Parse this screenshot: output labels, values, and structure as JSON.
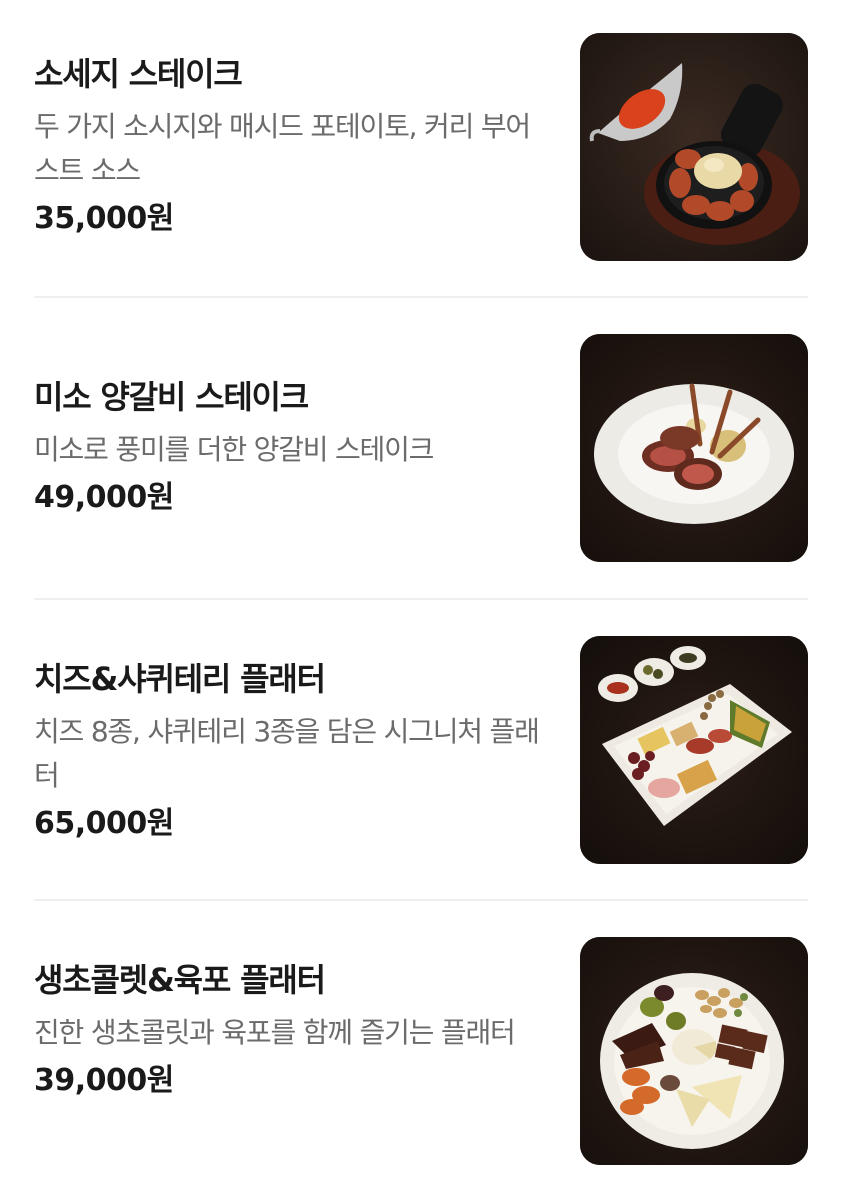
{
  "menu": {
    "currency_suffix": "원",
    "items": [
      {
        "name": "소세지 스테이크",
        "description": "두 가지 소시지와 매시드 포테이토, 커리 부어스트 소스",
        "price": "35,000원",
        "image_alt": "sausage-steak-photo"
      },
      {
        "name": "미소 양갈비 스테이크",
        "description": "미소로 풍미를 더한 양갈비 스테이크",
        "price": "49,000원",
        "image_alt": "miso-lamb-chop-photo"
      },
      {
        "name": "치즈&샤퀴테리 플래터",
        "description": "치즈 8종, 샤퀴테리 3종을 담은 시그니처 플래터",
        "price": "65,000원",
        "image_alt": "cheese-charcuterie-platter-photo"
      },
      {
        "name": "생초콜렛&육포 플래터",
        "description": "진한 생초콜릿과 육포를 함께 즐기는 플래터",
        "price": "39,000원",
        "image_alt": "chocolate-jerky-platter-photo"
      }
    ]
  },
  "colors": {
    "background": "#ffffff",
    "title": "#1a1a1a",
    "description": "#6b6b6b",
    "divider": "#efefef",
    "photo_backdrop": "#241a15"
  }
}
